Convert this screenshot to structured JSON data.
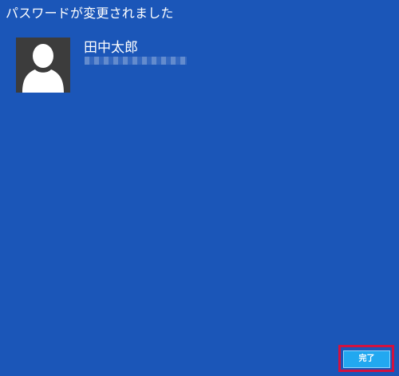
{
  "dialog": {
    "title": "パスワードが変更されました"
  },
  "account": {
    "avatar_icon": "person-silhouette-icon",
    "name": "田中太郎",
    "email": ""
  },
  "actions": {
    "done_label": "完了"
  },
  "colors": {
    "background": "#1b56b8",
    "avatar_background": "#3c3c3c",
    "button_background": "#22a8f0",
    "highlight_border": "#d21240"
  }
}
